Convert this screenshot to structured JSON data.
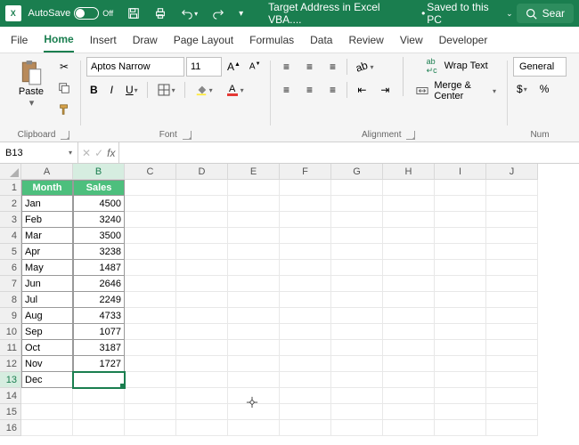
{
  "titlebar": {
    "autosave_label": "AutoSave",
    "autosave_state": "Off",
    "doc_title": "Target Address in Excel VBA....",
    "saved_label": "Saved to this PC",
    "search_label": "Sear"
  },
  "tabs": {
    "file": "File",
    "home": "Home",
    "insert": "Insert",
    "draw": "Draw",
    "page_layout": "Page Layout",
    "formulas": "Formulas",
    "data": "Data",
    "review": "Review",
    "view": "View",
    "developer": "Developer"
  },
  "ribbon": {
    "clipboard": {
      "label": "Clipboard",
      "paste": "Paste"
    },
    "font": {
      "label": "Font",
      "name": "Aptos Narrow",
      "size": "11",
      "bold": "B",
      "italic": "I",
      "underline": "U"
    },
    "alignment": {
      "label": "Alignment",
      "wrap": "Wrap Text",
      "merge": "Merge & Center"
    },
    "number": {
      "label": "Num",
      "format": "General",
      "currency": "$",
      "percent": "%"
    }
  },
  "namebox": "B13",
  "formula": "",
  "columns": [
    "A",
    "B",
    "C",
    "D",
    "E",
    "F",
    "G",
    "H",
    "I",
    "J"
  ],
  "rows": [
    1,
    2,
    3,
    4,
    5,
    6,
    7,
    8,
    9,
    10,
    11,
    12,
    13,
    14,
    15,
    16
  ],
  "sheet": {
    "headers": {
      "month": "Month",
      "sales": "Sales"
    },
    "data": [
      {
        "month": "Jan",
        "sales": 4500
      },
      {
        "month": "Feb",
        "sales": 3240
      },
      {
        "month": "Mar",
        "sales": 3500
      },
      {
        "month": "Apr",
        "sales": 3238
      },
      {
        "month": "May",
        "sales": 1487
      },
      {
        "month": "Jun",
        "sales": 2646
      },
      {
        "month": "Jul",
        "sales": 2249
      },
      {
        "month": "Aug",
        "sales": 4733
      },
      {
        "month": "Sep",
        "sales": 1077
      },
      {
        "month": "Oct",
        "sales": 3187
      },
      {
        "month": "Nov",
        "sales": 1727
      },
      {
        "month": "Dec",
        "sales": ""
      }
    ]
  },
  "selected": {
    "row": 13,
    "col": "B"
  }
}
